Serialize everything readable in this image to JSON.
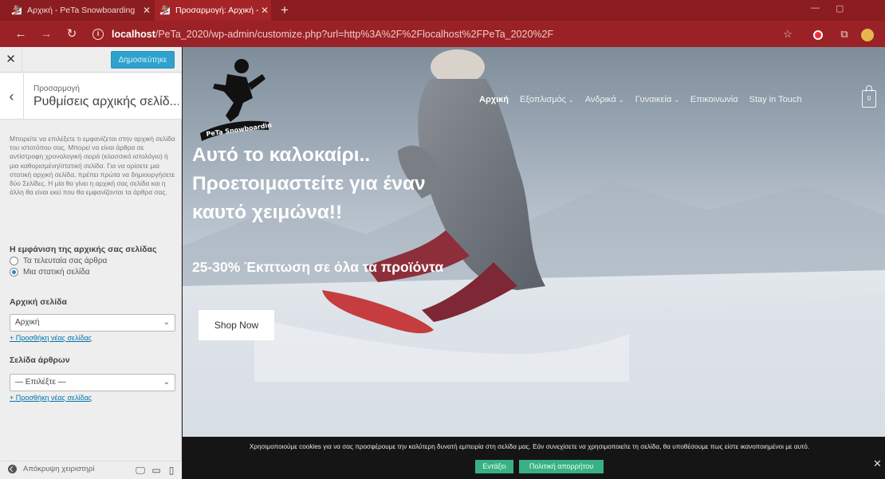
{
  "browser": {
    "tabs": [
      {
        "title": "Αρχική - PeTa Snowboarding",
        "active": false
      },
      {
        "title": "Προσαρμογή: Αρχική - PeTa Sno",
        "active": true
      }
    ],
    "url_host": "localhost",
    "url_path": "/PeTa_2020/wp-admin/customize.php?url=http%3A%2F%2Flocalhost%2FPeTa_2020%2F",
    "accent": "#9a2226"
  },
  "customizer": {
    "publish_label": "Δημοσιεύτηκε",
    "breadcrumb": "Προσαρμογή",
    "title": "Ρυθμίσεις αρχικής σελίδ...",
    "description": "Μπορείτε να επιλέξετε τι εμφανίζεται στην αρχική σελίδα του ιστοτόπου σας. Μπορεί να είναι άρθρα σε αντίστροφη χρονολογική σειρά (κλασσικό ιστολόγιο) ή μια καθορισμένη/στατική σελίδα. Για να ορίσετε μια στατική αρχική σελίδα, πρέπει πρώτα να δημιουργήσετε δύο Σελίδες. Η μία θα γίνει η αρχική σας σελίδα και η άλλη θα είναι εκεί που θα εμφανίζονται τα άρθρα σας.",
    "display_section": {
      "title": "Η εμφάνιση της αρχικής σας σελίδας",
      "options": [
        {
          "label": "Τα τελευταία σας άρθρα",
          "selected": false
        },
        {
          "label": "Μια στατική σελίδα",
          "selected": true
        }
      ]
    },
    "homepage": {
      "title": "Αρχική σελίδα",
      "selected": "Αρχική",
      "add_link": "+ Προσθήκη νέας σελίδας"
    },
    "posts_page": {
      "title": "Σελίδα άρθρων",
      "selected": "— Επιλέξτε —",
      "add_link": "+ Προσθήκη νέας σελίδας"
    },
    "hide_controls": "Απόκρυψη χειριστηρί"
  },
  "site": {
    "logo_text": "PeTa Snowboarding",
    "menu": [
      {
        "label": "Αρχική",
        "dropdown": false,
        "active": true
      },
      {
        "label": "Εξοπλισμός",
        "dropdown": true,
        "active": false
      },
      {
        "label": "Ανδρικά",
        "dropdown": true,
        "active": false
      },
      {
        "label": "Γυναικεία",
        "dropdown": true,
        "active": false
      },
      {
        "label": "Επικοινωνία",
        "dropdown": false,
        "active": false
      },
      {
        "label": "Stay in Touch",
        "dropdown": false,
        "active": false
      }
    ],
    "cart_count": "0",
    "hero_title_lines": [
      "Αυτό το καλοκαίρι..",
      "Προετοιμαστείτε για έναν",
      "καυτό χειμώνα!!"
    ],
    "hero_subtitle": "25-30% Έκπτωση σε όλα τα προϊόντα",
    "cta_label": "Shop Now",
    "cookie": {
      "text": "Χρησιμοποιούμε cookies για να σας προσφέρουμε την καλύτερη δυνατή εμπειρία στη σελίδα μας. Εάν συνεχίσετε να χρησιμοποιείτε τη σελίδα, θα υποθέσουμε πως είστε ικανοποιημένοι με αυτό.",
      "accept_label": "Εντάξει",
      "policy_label": "Πολιτική απορρήτου",
      "accent": "#39b184"
    }
  }
}
